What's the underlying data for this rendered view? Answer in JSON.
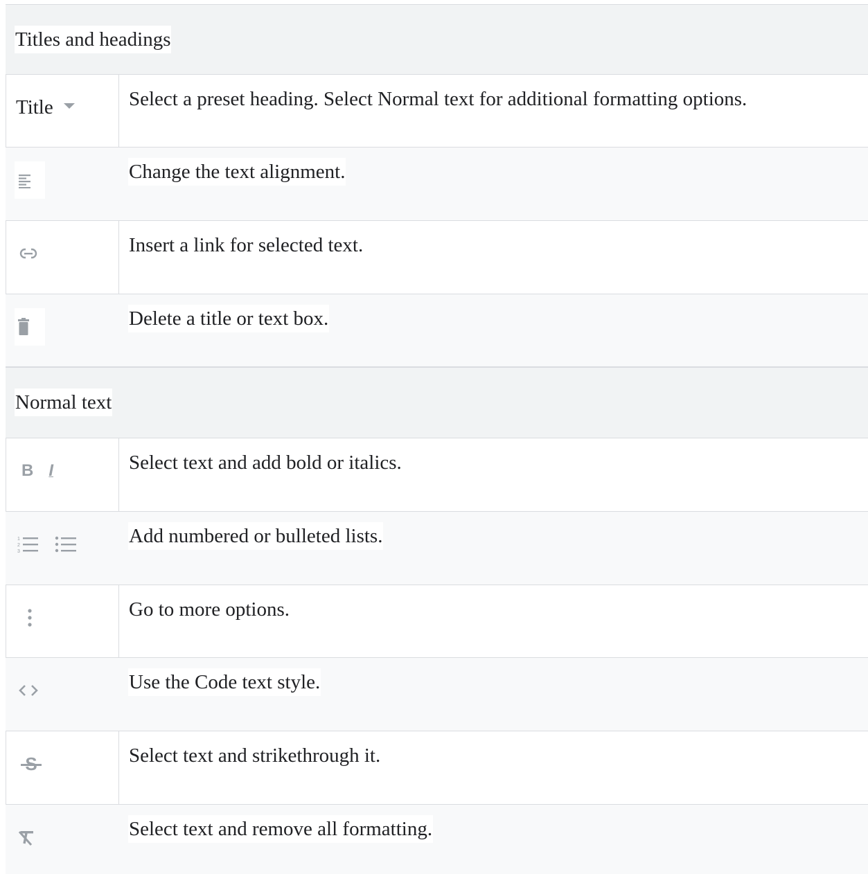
{
  "sections": [
    {
      "label": "Titles and headings"
    },
    {
      "label": "Normal text"
    }
  ],
  "rows": [
    {
      "icon": "title-dropdown",
      "title_label": "Title",
      "description": "Select a preset heading. Select Normal text for additional formatting options."
    },
    {
      "icon": "align-left-icon",
      "description": "Change the text alignment."
    },
    {
      "icon": "link-icon",
      "description": "Insert a link for selected text."
    },
    {
      "icon": "trash-icon",
      "description": "Delete a title or text box."
    },
    {
      "icon": "bold-italic-icons",
      "description": "Select text and add bold or italics."
    },
    {
      "icon": "list-icons",
      "description": "Add numbered or bulleted lists."
    },
    {
      "icon": "more-vert-icon",
      "description": "Go to more options."
    },
    {
      "icon": "code-icon",
      "description": "Use the Code text style."
    },
    {
      "icon": "strikethrough-icon",
      "description": "Select text and strikethrough it."
    },
    {
      "icon": "clear-format-icon",
      "description": "Select text and remove all formatting."
    }
  ],
  "colors": {
    "border": "#dadce0",
    "section_bg": "#f1f3f4",
    "alt_row_bg": "#f8f9fa",
    "icon": "#9aa0a6"
  }
}
